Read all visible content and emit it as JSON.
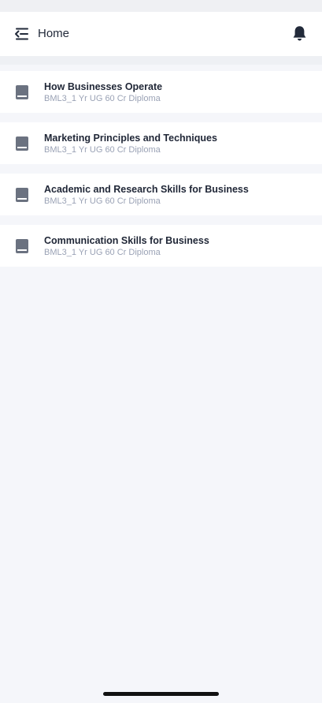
{
  "header": {
    "title": "Home",
    "menu_icon": "menu-icon",
    "notification_icon": "bell-icon"
  },
  "courses": [
    {
      "title": "How Businesses Operate",
      "subtitle": "BML3_1 Yr UG 60 Cr Diploma"
    },
    {
      "title": "Marketing Principles and Techniques",
      "subtitle": "BML3_1 Yr UG 60 Cr Diploma"
    },
    {
      "title": "Academic and Research Skills for Business",
      "subtitle": "BML3_1 Yr UG 60 Cr Diploma"
    },
    {
      "title": "Communication Skills for Business",
      "subtitle": "BML3_1 Yr UG 60 Cr Diploma"
    }
  ],
  "colors": {
    "background": "#f5f6fa",
    "card": "#ffffff",
    "title_text": "#1f2636",
    "subtitle_text": "#9aa2b5",
    "icon": "#6b7280"
  }
}
